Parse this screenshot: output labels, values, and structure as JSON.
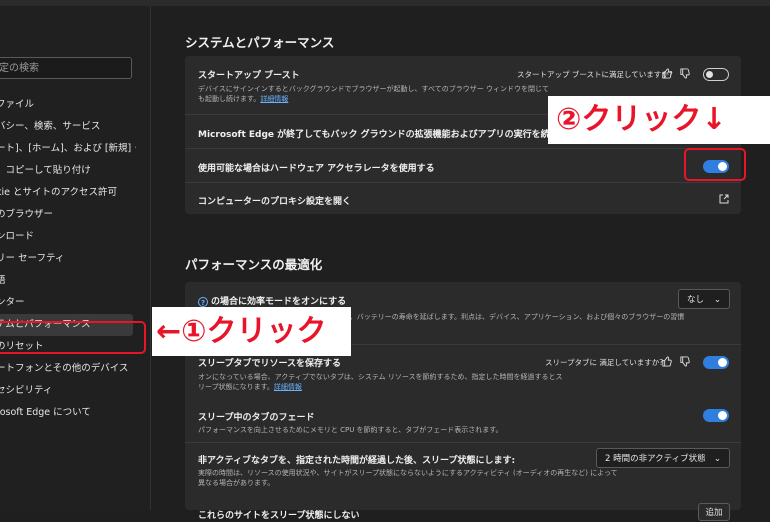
{
  "sidebar": {
    "search_placeholder": "定の検索",
    "items": [
      {
        "label": "ファイル"
      },
      {
        "label": "バシー、検索、サービス"
      },
      {
        "label": "ート]、[ホーム]、および [新規] タブ"
      },
      {
        "label": "、コピーして貼り付け"
      },
      {
        "label": "kie とサイトのアクセス許可"
      },
      {
        "label": "のブラウザー"
      },
      {
        "label": "ンロード"
      },
      {
        "label": "リー セーフティ"
      },
      {
        "label": "語"
      },
      {
        "label": "ンター"
      },
      {
        "label": "テムとパフォーマンス",
        "active": true
      },
      {
        "label": "のリセット"
      },
      {
        "label": "ートフォンとその他のデバイス"
      },
      {
        "label": "セシビリティ"
      },
      {
        "label": "rosoft Edge について"
      }
    ]
  },
  "system": {
    "heading": "システムとパフォーマンス",
    "startup_title": "スタートアップ ブースト",
    "startup_question": "スタートアップ ブーストに満足していますか?",
    "startup_desc1": "デバイスにサインインするとバックグラウンドでブラウザーが起動し、すべてのブラウザー ウィンドウを閉じて",
    "startup_desc2": "も起動し続けます。",
    "startup_link": "詳細情報",
    "startup_toggle": false,
    "bg_title": "Microsoft Edge が終了してもバック グラウンドの拡張機能およびアプリの実行を続行する",
    "hw_title": "使用可能な場合はハードウェア アクセラレータを使用する",
    "hw_toggle": true,
    "proxy_title": "コンピューターのプロキシ設定を開く"
  },
  "perf": {
    "heading": "パフォーマンスの最適化",
    "eff_title": "の場合に効率モードをオンにする",
    "eff_desc": "で、バッテリーの寿命を延ばします。利点は、デバイス、アプリケーション、および個々のブラウザーの習慣",
    "eff_dropdown": "なし",
    "sleep_title": "スリープタブでリソースを保存する",
    "sleep_question": "スリープタブに 満足していますか?",
    "sleep_desc1": "オンになっている場合、アクティブでないタブは、システム リソースを節約するため、指定した時間を経過するとス",
    "sleep_desc2": "リープ状態になります。",
    "sleep_link": "詳細情報",
    "sleep_toggle": true,
    "fade_title": "スリープ中のタブのフェード",
    "fade_desc": "パフォーマンスを向上させるためにメモリと CPU を節約すると、タブがフェード表示されます。",
    "fade_toggle": true,
    "inactive_title": "非アクティブなタブを、指定された時間が経過した後、スリープ状態にします:",
    "inactive_desc1": "実際の時間は、リソースの使用状況や、サイトがスリープ状態にならないようにするアクティビティ (オーディオの再生など) によって",
    "inactive_desc2": "異なる場合があります。",
    "inactive_dropdown": "2 時間の非アクティブ状態",
    "never_title": "これらのサイトをスリープ状態にしない",
    "add_button": "追加"
  },
  "callouts": {
    "step1": "←①クリック",
    "step2": "②クリック↓"
  },
  "colors": {
    "accent": "#2f7ee0",
    "annotation_red": "#e8142a",
    "link": "#6cb2ff"
  }
}
